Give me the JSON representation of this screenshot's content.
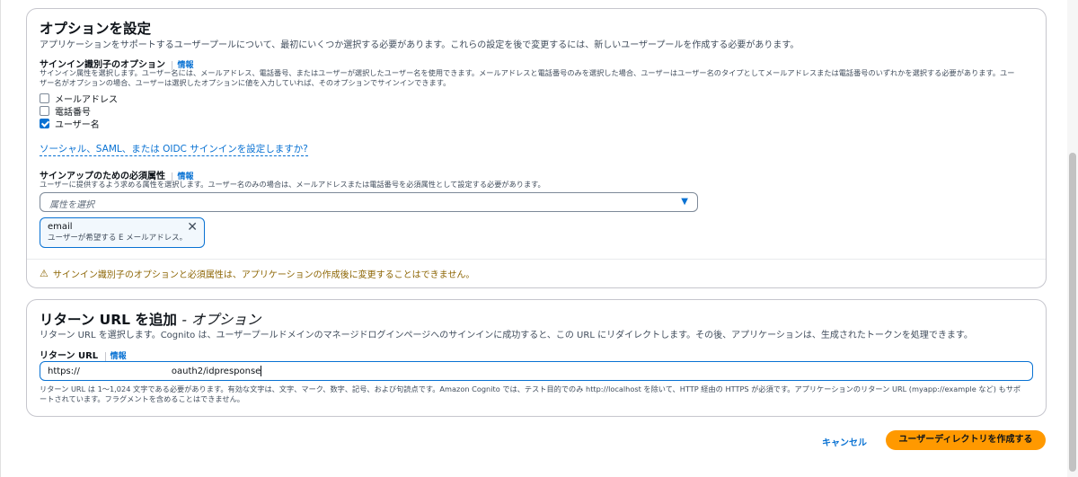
{
  "options": {
    "title": "オプションを設定",
    "description": "アプリケーションをサポートするユーザープールについて、最初にいくつか選択する必要があります。これらの設定を後で変更するには、新しいユーザープールを作成する必要があります。",
    "signin": {
      "label": "サインイン識別子のオプション",
      "info": "情報",
      "help_line1": "サインイン属性を選択します。ユーザー名には、メールアドレス、電話番号、またはユーザーが選択したユーザー名を使用できます。メールアドレスと電話番号のみを選択した場合、ユーザーはユーザー名のタイプとしてメールアドレスまたは電話番号のいずれかを選択する必要があります。ユー",
      "help_line2": "ザー名がオプションの場合、ユーザーは選択したオプションに値を入力していれば、そのオプションでサインインできます。",
      "checkboxes": [
        {
          "label": "メールアドレス",
          "checked": false
        },
        {
          "label": "電話番号",
          "checked": false
        },
        {
          "label": "ユーザー名",
          "checked": true
        }
      ]
    },
    "social_link": "ソーシャル、SAML、または OIDC サインインを設定しますか?",
    "signup": {
      "label": "サインアップのための必須属性",
      "info": "情報",
      "help": "ユーザーに提供するよう求める属性を選択します。ユーザー名のみの場合は、メールアドレスまたは電話番号を必須属性として設定する必要があります。",
      "select_placeholder": "属性を選択",
      "token": {
        "name": "email",
        "description": "ユーザーが希望する E メールアドレス。"
      }
    },
    "warning": "サインイン識別子のオプションと必須属性は、アプリケーションの作成後に変更することはできません。"
  },
  "return_url": {
    "title": "リターン URL を追加",
    "title_suffix": "- オプション",
    "description": "リターン URL を選択します。Cognito は、ユーザープールドメインのマネージドログインページへのサインインに成功すると、この URL にリダイレクトします。その後、アプリケーションは、生成されたトークンを処理できます。",
    "label": "リターン URL",
    "info": "情報",
    "value_prefix": "https://",
    "value_suffix": "oauth2/idpresponse",
    "help_line1": "リターン URL は 1～1,024 文字である必要があります。有効な文字は、文字、マーク、数字、記号、および句読点です。Amazon Cognito では、テスト目的でのみ http://localhost を除いて、HTTP 経由の HTTPS が必須です。アプリケーションのリターン URL (myapp://example など) もサポ",
    "help_line2": "ートされています。フラグメントを含めることはできません。"
  },
  "footer": {
    "cancel": "キャンセル",
    "create": "ユーザーディレクトリを作成する"
  },
  "colors": {
    "link": "#0972d3",
    "primary_button": "#ff9900",
    "warning": "#8d6605"
  }
}
